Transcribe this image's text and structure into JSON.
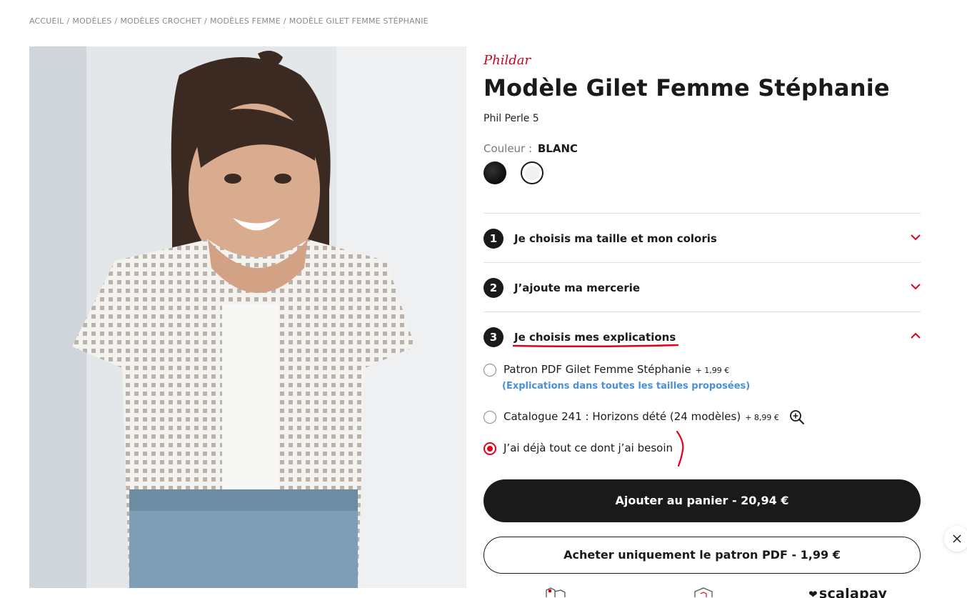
{
  "breadcrumb": {
    "items": [
      "ACCUEIL",
      "MODÈLES",
      "MODÈLES CROCHET",
      "MODÈLES FEMME",
      "MODÈLE GILET FEMME STÉPHANIE"
    ],
    "separator": "/"
  },
  "brand": {
    "logo_text": "Phildar"
  },
  "product": {
    "title": "Modèle Gilet Femme Stéphanie",
    "subtitle": "Phil Perle 5",
    "color_label": "Couleur :",
    "color_value": "BLANC",
    "swatches": [
      {
        "name": "black",
        "color": "#111111",
        "selected": false
      },
      {
        "name": "white",
        "color": "#f1f1f1",
        "selected": true
      }
    ]
  },
  "steps": [
    {
      "number": "1",
      "label": "Je choisis ma taille et mon coloris",
      "expanded": false
    },
    {
      "number": "2",
      "label": "J’ajoute ma mercerie",
      "expanded": false
    },
    {
      "number": "3",
      "label": "Je choisis mes explications",
      "expanded": true
    }
  ],
  "options": [
    {
      "label": "Patron PDF Gilet Femme Stéphanie",
      "price": "+ 1,99 €",
      "note": "(Explications dans toutes les tailles proposées)",
      "selected": false
    },
    {
      "label": "Catalogue 241 : Horizons dété (24 modèles)",
      "price": "+ 8,99 €",
      "selected": false
    },
    {
      "label": "J’ai déjà tout ce dont j’ai besoin",
      "selected": true
    }
  ],
  "buttons": {
    "add_to_cart": "Ajouter au panier - 20,94 €",
    "buy_pdf": "Acheter uniquement le patron PDF - 1,99 €"
  },
  "footer": {
    "scalapay_label": "scalapay"
  },
  "colors": {
    "accent_red": "#e2001a",
    "dark": "#1a1a1a",
    "link_blue": "#4a90d9",
    "annotation_red": "#e2001a"
  },
  "icons": [
    "chevron-down-icon",
    "chevron-up-icon",
    "zoom-in-icon",
    "close-icon",
    "heart-icon"
  ]
}
